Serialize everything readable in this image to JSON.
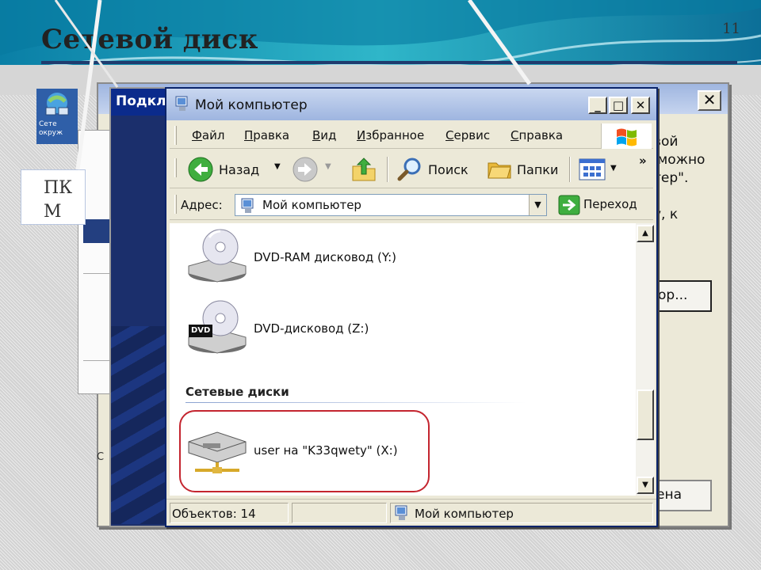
{
  "slide": {
    "title": "Сетевой диск",
    "number": "11"
  },
  "desktop_icon": {
    "label": "Сете\nокруж",
    "icon": "network-computers-icon"
  },
  "note": {
    "text": "ПК\nМ"
  },
  "back_dialog": {
    "text": "вой\n можно\nтер\".\n\nу, к",
    "browse_button": "ор...",
    "cancel_button": "ена",
    "close": "✕",
    "left_strip": "C"
  },
  "connect_dialog": {
    "title": "Подкл"
  },
  "explorer": {
    "title": "Мой компьютер",
    "window_buttons": {
      "minimize": "_",
      "maximize": "□",
      "close": "✕"
    },
    "menu": [
      "Файл",
      "Правка",
      "Вид",
      "Избранное",
      "Сервис",
      "Справка"
    ],
    "toolbar": {
      "back": "Назад",
      "search": "Поиск",
      "folders": "Папки",
      "more": "»"
    },
    "address": {
      "label": "Адрес:",
      "value": "Мой компьютер",
      "go": "Переход"
    },
    "drives": [
      {
        "label": "DVD-RAM дисковод (Y:)",
        "icon": "dvd-ram-drive-icon"
      },
      {
        "label": "DVD-дисковод (Z:)",
        "icon": "dvd-drive-icon",
        "badge": "DVD"
      }
    ],
    "network_group": {
      "heading": "Сетевые диски",
      "drives": [
        {
          "label": "user на \"K33qwety\" (X:)",
          "icon": "network-drive-icon"
        }
      ]
    },
    "status": {
      "objects": "Объектов: 14",
      "location": "Мой компьютер"
    }
  },
  "colors": {
    "slide_rule": "#1f3b6e",
    "highlight": "#c4252f",
    "titlebar_active": "#9eb5e0",
    "connect_bg": "#1b2f6c"
  }
}
